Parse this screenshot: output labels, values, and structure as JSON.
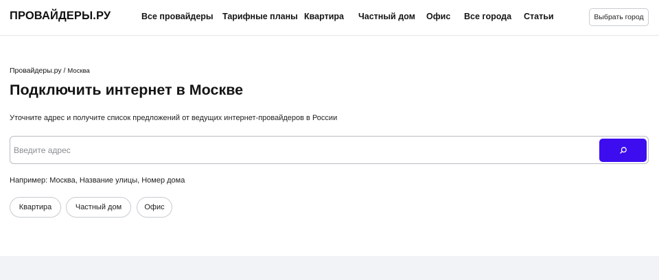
{
  "header": {
    "logo": "ПРОВАЙДЕРЫ.РУ",
    "nav": [
      {
        "label": "Все провайдеры"
      },
      {
        "label": "Тарифные планы"
      },
      {
        "label": "Квартира"
      },
      {
        "label": "Частный дом"
      },
      {
        "label": "Офис"
      },
      {
        "label": "Все города"
      },
      {
        "label": "Статьи"
      }
    ],
    "city_button": "Выбрать город"
  },
  "breadcrumb": {
    "home": "Провайдеры.ру",
    "separator": " / ",
    "current": "Москва"
  },
  "main": {
    "title": "Подключить интернет в Москве",
    "subtitle": "Уточните адрес и получите список предложений от ведущих интернет-провайдеров в России",
    "search": {
      "placeholder": "Введите адрес",
      "value": "",
      "button_icon": "search-icon"
    },
    "example": "Например: Москва, Название улицы, Номер дома",
    "chips": [
      {
        "label": "Квартира"
      },
      {
        "label": "Частный дом"
      },
      {
        "label": "Офис"
      }
    ]
  },
  "colors": {
    "accent": "#3d0df0",
    "footer_band": "#f1f3f7",
    "border": "#c8cbd1"
  }
}
